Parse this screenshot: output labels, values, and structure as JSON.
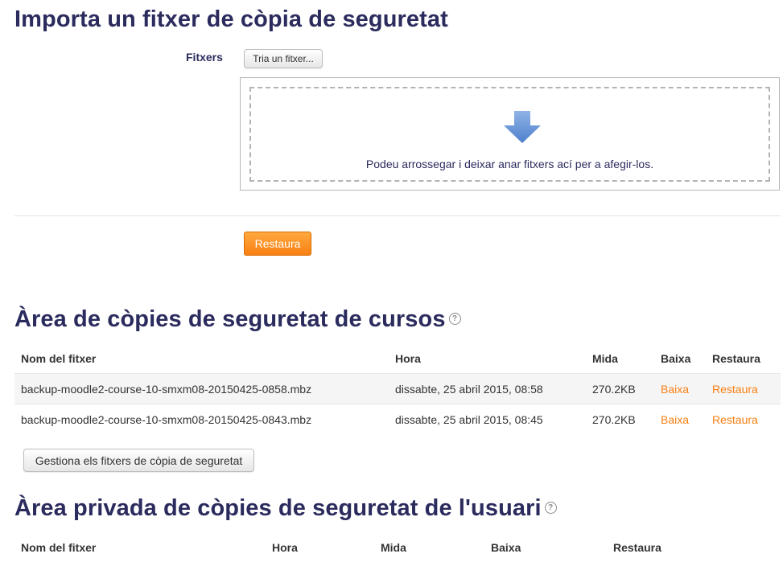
{
  "import_section": {
    "title": "Importa un fitxer de còpia de seguretat",
    "files_label": "Fitxers",
    "choose_file_button": "Tria un fitxer...",
    "drop_text": "Podeu arrossegar i deixar anar fitxers ací per a afegir-los.",
    "restore_button": "Restaura"
  },
  "course_backups": {
    "title": "Àrea de còpies de seguretat de cursos",
    "help_icon": "question-circle-icon",
    "columns": [
      "Nom del fitxer",
      "Hora",
      "Mida",
      "Baixa",
      "Restaura"
    ],
    "rows": [
      {
        "filename": "backup-moodle2-course-10-smxm08-20150425-0858.mbz",
        "time": "dissabte, 25 abril 2015, 08:58",
        "size": "270.2KB",
        "download": "Baixa",
        "restore": "Restaura"
      },
      {
        "filename": "backup-moodle2-course-10-smxm08-20150425-0843.mbz",
        "time": "dissabte, 25 abril 2015, 08:45",
        "size": "270.2KB",
        "download": "Baixa",
        "restore": "Restaura"
      }
    ],
    "manage_button": "Gestiona els fitxers de còpia de seguretat"
  },
  "user_backups": {
    "title": "Àrea privada de còpies de seguretat de l'usuari",
    "help_icon": "question-circle-icon",
    "columns": [
      "Nom del fitxer",
      "Hora",
      "Mida",
      "Baixa",
      "Restaura"
    ]
  },
  "colors": {
    "heading": "#2b2b5e",
    "accent": "#f98012",
    "arrow": "#6e9ad8"
  }
}
